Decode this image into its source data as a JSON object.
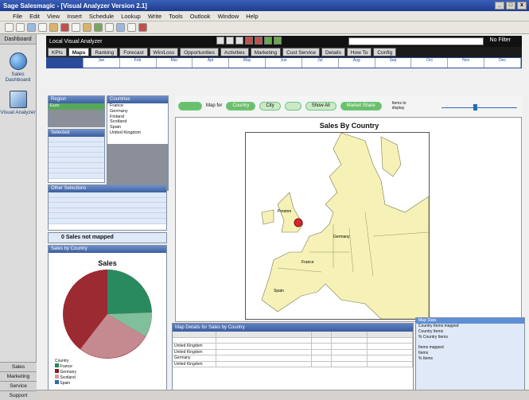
{
  "window": {
    "title": "Sage Salesmagic - [Visual Analyzer Version 2.1]"
  },
  "menu": [
    "File",
    "Edit",
    "View",
    "Insert",
    "Schedule",
    "Lookup",
    "Write",
    "Tools",
    "Outlook",
    "Window",
    "Help"
  ],
  "leftnav": {
    "top_tab": "Dashboard",
    "items": [
      {
        "label": "Sales Dashboard",
        "icon": "globe-icon"
      },
      {
        "label": "Visual Analyzer",
        "icon": "analyzer-icon"
      }
    ],
    "bottom": [
      "Sales",
      "Marketing",
      "Service",
      "Support"
    ]
  },
  "header": {
    "title": "Local Visual Analyzer",
    "filter": "No Filter"
  },
  "tabs": [
    "KPIs",
    "Maps",
    "Ranking",
    "Forecast",
    "Win/Loss",
    "Opportunities",
    "Activities",
    "Marketing",
    "Cust Service",
    "Details",
    "How To",
    "Config"
  ],
  "active_tab": "Maps",
  "months": [
    "Jan",
    "Feb",
    "Mar",
    "Apr",
    "May",
    "Jun",
    "Jul",
    "Aug",
    "Sep",
    "Oct",
    "Nov",
    "Dec"
  ],
  "region_panel": {
    "title": "Region",
    "items": [
      "Euro",
      "",
      "",
      ""
    ]
  },
  "country_panel": {
    "title": "Countries",
    "items": [
      "France",
      "Germany",
      "Finland",
      "Scotland",
      "Spain",
      "United Kingdom"
    ]
  },
  "selected_panel": {
    "title": "Selected"
  },
  "other_panel": {
    "title": "Other Selections"
  },
  "not_mapped": "0 Sales not mapped",
  "map_controls": {
    "map_label": "Map for",
    "buttons": [
      "Country",
      "City",
      "",
      "Show All",
      "Market Share"
    ],
    "zoom_label": "Items to display"
  },
  "map": {
    "title": "Sales By Country",
    "labels": [
      "Preston",
      "Germany",
      "France",
      "Spain"
    ]
  },
  "pie": {
    "panel_title": "Sales by Country",
    "title": "Sales",
    "legend_title": "Country",
    "legend": [
      "France",
      "Germany",
      "Scotland",
      "Spain"
    ],
    "colors": [
      "#1f8a5b",
      "#8c1c24",
      "#d99aa0",
      "#2a6bb8"
    ]
  },
  "grid": {
    "title": "Map Details for Sales by Country",
    "rows": [
      "United Kingdom",
      "United Kingdom",
      "Germany",
      "United Kingdom"
    ]
  },
  "stats": {
    "title": "Map Stats",
    "rows": [
      "Country Items mapped",
      "Country Items",
      "% Country Items",
      "Items mapped",
      "Items",
      "% Items"
    ]
  }
}
